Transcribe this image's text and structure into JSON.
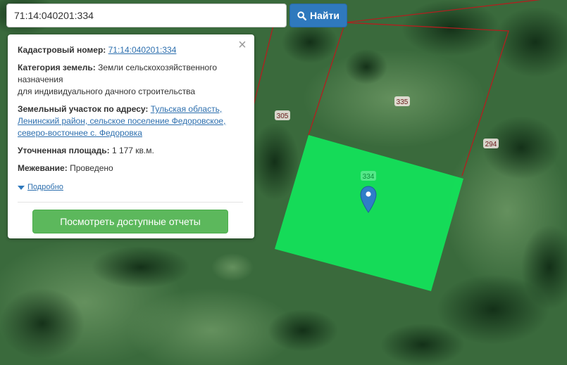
{
  "search": {
    "value": "71:14:040201:334",
    "button_label": "Найти"
  },
  "info": {
    "cadastral_label": "Кадастровый номер:",
    "cadastral_value": "71:14:040201:334",
    "category_label": "Категория земель:",
    "category_value_1": "Земли сельскохозяйственного",
    "category_value_2": "назначения",
    "category_value_3": "для индивидуального дачного строительства",
    "address_label": "Земельный участок по адресу:",
    "address_value_1": "Тульская область,",
    "address_value_2": "Ленинский район, сельское поселение Федоровское,",
    "address_value_3": "северо-восточнее с. Федоровка",
    "area_label": "Уточненная площадь:",
    "area_value": "1 177 кв.м.",
    "survey_label": "Межевание:",
    "survey_value": "Проведено",
    "details_label": "Подробно",
    "reports_button": "Посмотреть доступные отчеты"
  },
  "map": {
    "parcel_labels": {
      "p305": "305",
      "p335": "335",
      "p294": "294",
      "p334": "334"
    },
    "colors": {
      "selected_parcel": "#13e25a",
      "boundary": "#b21f1f",
      "marker": "#2f7dc8"
    }
  }
}
